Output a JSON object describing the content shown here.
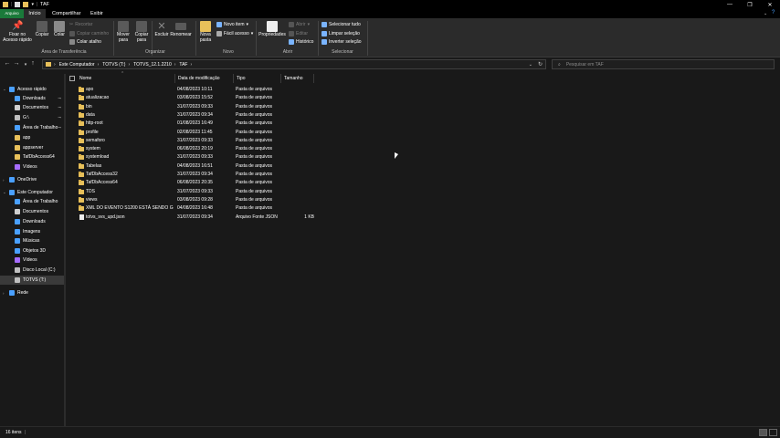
{
  "window": {
    "title": "TAF",
    "min_glyph": "—",
    "max_glyph": "❐",
    "close_glyph": "✕"
  },
  "ribbon_tabs": [
    {
      "label": "Arquivo"
    },
    {
      "label": "Início"
    },
    {
      "label": "Compartilhar"
    },
    {
      "label": "Exibir"
    }
  ],
  "ribbon": {
    "pin_quick": "Fixar no Acesso rápido",
    "copy": "Copiar",
    "paste": "Colar",
    "cut": "Recortar",
    "copy_path": "Copiar caminho",
    "paste_shortcut": "Colar atalho",
    "group_clipboard": "Área de Transferência",
    "move_to": "Mover para",
    "copy_to": "Copiar para",
    "delete": "Excluir",
    "rename": "Renomear",
    "group_organize": "Organizar",
    "new_folder": "Nova pasta",
    "new_item": "Novo item",
    "easy_access": "Fácil acesso",
    "group_new": "Novo",
    "properties": "Propriedades",
    "open": "Abrir",
    "edit": "Editar",
    "history": "Histórico",
    "group_open": "Abrir",
    "select_all": "Selecionar tudo",
    "select_none": "Limpar seleção",
    "invert_selection": "Inverter seleção",
    "group_select": "Selecionar"
  },
  "address": {
    "crumbs": [
      "Este Computador",
      "TOTVS (T:)",
      "TOTVS_12.1.2210",
      "TAF"
    ],
    "search_placeholder": "Pesquisar em TAF"
  },
  "nav": {
    "items": [
      {
        "label": "Acesso rápido",
        "icon": "star-icon",
        "pinned": false
      },
      {
        "label": "Downloads",
        "icon": "download-icon",
        "pinned": true
      },
      {
        "label": "Documentos",
        "icon": "document-icon",
        "pinned": true
      },
      {
        "label": "G:\\",
        "icon": "drive-icon",
        "pinned": true
      },
      {
        "label": "Área de Trabalho",
        "icon": "desktop-icon",
        "pinned": true
      },
      {
        "label": "app",
        "icon": "folder-icon",
        "pinned": false
      },
      {
        "label": "appserver",
        "icon": "folder-icon",
        "pinned": false
      },
      {
        "label": "TafDbAccess64",
        "icon": "folder-icon",
        "pinned": false
      },
      {
        "label": "Vídeos",
        "icon": "video-icon",
        "pinned": false
      },
      {
        "label": "OneDrive",
        "icon": "cloud-icon",
        "pinned": false
      },
      {
        "label": "Este Computador",
        "icon": "computer-icon",
        "pinned": false
      },
      {
        "label": "Área de Trabalho",
        "icon": "desktop-icon",
        "pinned": false
      },
      {
        "label": "Documentos",
        "icon": "document-icon",
        "pinned": false
      },
      {
        "label": "Downloads",
        "icon": "download-icon",
        "pinned": false
      },
      {
        "label": "Imagens",
        "icon": "image-icon",
        "pinned": false
      },
      {
        "label": "Músicas",
        "icon": "music-icon",
        "pinned": false
      },
      {
        "label": "Objetos 3D",
        "icon": "cube-icon",
        "pinned": false
      },
      {
        "label": "Vídeos",
        "icon": "video-icon",
        "pinned": false
      },
      {
        "label": "Disco Local (C:)",
        "icon": "drive-icon",
        "pinned": false
      },
      {
        "label": "TOTVS (T:)",
        "icon": "drive-icon",
        "pinned": false
      },
      {
        "label": "Rede",
        "icon": "network-icon",
        "pinned": false
      }
    ]
  },
  "columns": {
    "name": "Nome",
    "modified": "Data de modificação",
    "type": "Tipo",
    "size": "Tamanho"
  },
  "files": [
    {
      "name": "apo",
      "modified": "04/08/2023 10:11",
      "type": "Pasta de arquivos",
      "size": "",
      "kind": "folder"
    },
    {
      "name": "atualizacao",
      "modified": "03/08/2023 15:52",
      "type": "Pasta de arquivos",
      "size": "",
      "kind": "folder"
    },
    {
      "name": "bin",
      "modified": "31/07/2023 09:33",
      "type": "Pasta de arquivos",
      "size": "",
      "kind": "folder"
    },
    {
      "name": "data",
      "modified": "31/07/2023 09:34",
      "type": "Pasta de arquivos",
      "size": "",
      "kind": "folder"
    },
    {
      "name": "http-root",
      "modified": "01/08/2023 16:49",
      "type": "Pasta de arquivos",
      "size": "",
      "kind": "folder"
    },
    {
      "name": "profile",
      "modified": "02/08/2023 11:45",
      "type": "Pasta de arquivos",
      "size": "",
      "kind": "folder"
    },
    {
      "name": "semaforo",
      "modified": "31/07/2023 09:33",
      "type": "Pasta de arquivos",
      "size": "",
      "kind": "folder"
    },
    {
      "name": "system",
      "modified": "06/08/2023 20:19",
      "type": "Pasta de arquivos",
      "size": "",
      "kind": "folder"
    },
    {
      "name": "systemload",
      "modified": "31/07/2023 09:33",
      "type": "Pasta de arquivos",
      "size": "",
      "kind": "folder"
    },
    {
      "name": "Tabelas",
      "modified": "04/08/2023 16:51",
      "type": "Pasta de arquivos",
      "size": "",
      "kind": "folder"
    },
    {
      "name": "TafDbAccess32",
      "modified": "31/07/2023 09:34",
      "type": "Pasta de arquivos",
      "size": "",
      "kind": "folder"
    },
    {
      "name": "TafDbAccess64",
      "modified": "06/08/2023 20:35",
      "type": "Pasta de arquivos",
      "size": "",
      "kind": "folder"
    },
    {
      "name": "TDS",
      "modified": "31/07/2023 09:33",
      "type": "Pasta de arquivos",
      "size": "",
      "kind": "folder"
    },
    {
      "name": "views",
      "modified": "03/08/2023 09:28",
      "type": "Pasta de arquivos",
      "size": "",
      "kind": "folder"
    },
    {
      "name": "XML DO EVENTO S1200 ESTÁ SENDO G...",
      "modified": "04/08/2023 16:48",
      "type": "Pasta de arquivos",
      "size": "",
      "kind": "folder"
    },
    {
      "name": "totvs_svs_upd.json",
      "modified": "31/07/2023 09:34",
      "type": "Arquivo Fonte JSON",
      "size": "1 KB",
      "kind": "file"
    }
  ],
  "status": {
    "count": "16 itens",
    "separator": "|"
  }
}
